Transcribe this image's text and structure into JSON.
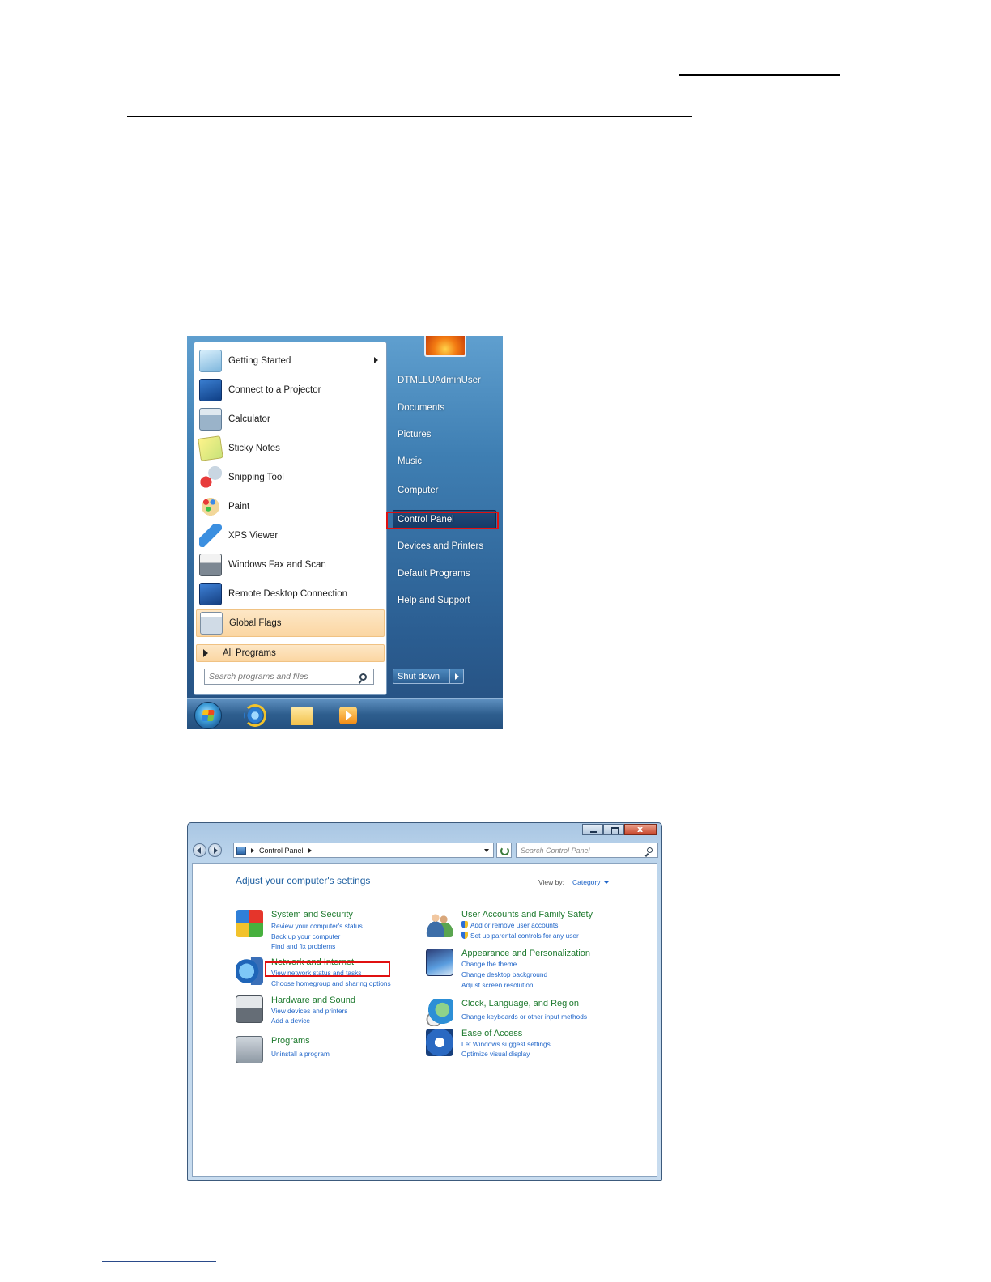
{
  "start_menu": {
    "programs": [
      {
        "label": "Getting Started",
        "icon": "getting-started-icon",
        "has_submenu": true
      },
      {
        "label": "Connect to a Projector",
        "icon": "projector-icon"
      },
      {
        "label": "Calculator",
        "icon": "calculator-icon"
      },
      {
        "label": "Sticky Notes",
        "icon": "sticky-notes-icon"
      },
      {
        "label": "Snipping Tool",
        "icon": "snipping-tool-icon"
      },
      {
        "label": "Paint",
        "icon": "paint-icon"
      },
      {
        "label": "XPS Viewer",
        "icon": "xps-viewer-icon"
      },
      {
        "label": "Windows Fax and Scan",
        "icon": "fax-scan-icon"
      },
      {
        "label": "Remote Desktop Connection",
        "icon": "remote-desktop-icon"
      },
      {
        "label": "Global Flags",
        "icon": "global-flags-icon",
        "highlighted": true
      }
    ],
    "all_programs": "All Programs",
    "search_placeholder": "Search programs and files",
    "right_items": [
      "DTMLLUAdminUser",
      "Documents",
      "Pictures",
      "Music",
      "Computer",
      "Control Panel",
      "Devices and Printers",
      "Default Programs",
      "Help and Support"
    ],
    "highlighted_item": "Control Panel",
    "shutdown_label": "Shut down",
    "highlight_color": "#e01010"
  },
  "control_panel": {
    "breadcrumb": "Control Panel",
    "search_placeholder": "Search Control Panel",
    "title": "Adjust your computer's settings",
    "view_by_label": "View by:",
    "view_by_value": "Category",
    "categories_left": [
      {
        "title": "System and Security",
        "icon": "system-security-icon",
        "links": [
          "Review your computer's status",
          "Back up your computer",
          "Find and fix problems"
        ]
      },
      {
        "title": "Network and Internet",
        "icon": "network-internet-icon",
        "links": [
          "View network status and tasks",
          "Choose homegroup and sharing options"
        ]
      },
      {
        "title": "Hardware and Sound",
        "icon": "hardware-sound-icon",
        "links": [
          "View devices and printers",
          "Add a device"
        ]
      },
      {
        "title": "Programs",
        "icon": "programs-icon",
        "links": [
          "Uninstall a program"
        ]
      }
    ],
    "categories_right": [
      {
        "title": "User Accounts and Family Safety",
        "icon": "user-accounts-icon",
        "links": [
          "Add or remove user accounts",
          "Set up parental controls for any user"
        ]
      },
      {
        "title": "Appearance and Personalization",
        "icon": "appearance-icon",
        "links": [
          "Change the theme",
          "Change desktop background",
          "Adjust screen resolution"
        ]
      },
      {
        "title": "Clock, Language, and Region",
        "icon": "clock-language-icon",
        "links": [
          "Change keyboards or other input methods"
        ]
      },
      {
        "title": "Ease of Access",
        "icon": "ease-of-access-icon",
        "links": [
          "Let Windows suggest settings",
          "Optimize visual display"
        ]
      }
    ],
    "highlighted_link": "View network status and tasks"
  }
}
